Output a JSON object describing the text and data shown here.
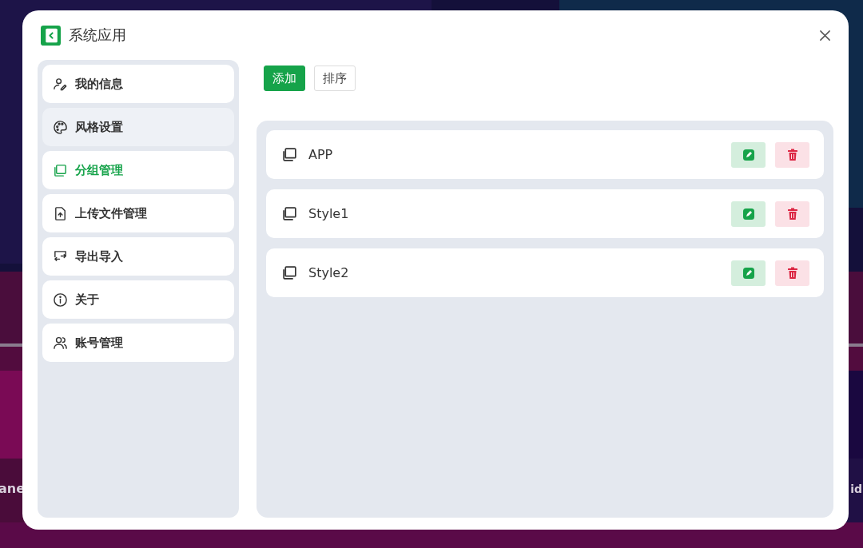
{
  "background_texts": [
    "ane",
    "id"
  ],
  "window": {
    "title": "系统应用"
  },
  "sidebar": {
    "items": [
      {
        "label": "我的信息",
        "kind": "user-edit",
        "selected": false,
        "hovered": false
      },
      {
        "label": "风格设置",
        "kind": "palette",
        "selected": false,
        "hovered": true
      },
      {
        "label": "分组管理",
        "kind": "group",
        "selected": true,
        "hovered": false
      },
      {
        "label": "上传文件管理",
        "kind": "upload",
        "selected": false,
        "hovered": false
      },
      {
        "label": "导出导入",
        "kind": "transfer",
        "selected": false,
        "hovered": false
      },
      {
        "label": "关于",
        "kind": "info",
        "selected": false,
        "hovered": false
      },
      {
        "label": "账号管理",
        "kind": "users",
        "selected": false,
        "hovered": false
      }
    ]
  },
  "toolbar": {
    "buttons": [
      {
        "label": "添加",
        "kind": "primary"
      },
      {
        "label": "排序",
        "kind": "default"
      }
    ]
  },
  "groups": [
    {
      "name": "APP"
    },
    {
      "name": "Style1"
    },
    {
      "name": "Style2"
    }
  ]
}
